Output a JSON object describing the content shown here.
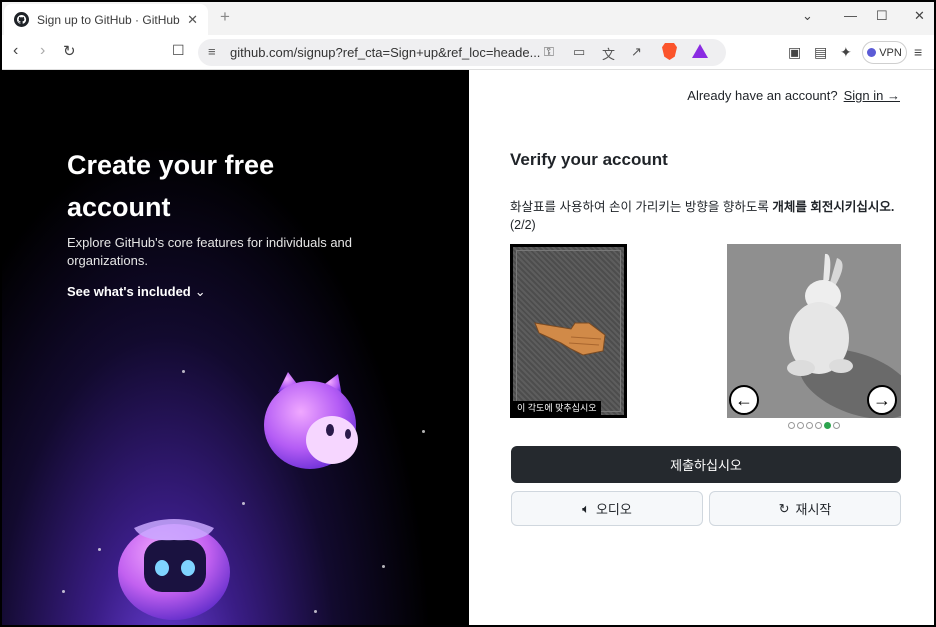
{
  "browser": {
    "tab_title": "Sign up to GitHub · GitHub",
    "tab_close": "✕",
    "new_tab": "+",
    "url": "github.com/signup?ref_cta=Sign+up&ref_loc=heade...",
    "vpn_label": "VPN",
    "window_controls": [
      "⌄",
      "—",
      "☐",
      "✕"
    ]
  },
  "left_panel": {
    "headline": "Create your free account",
    "subtext": "Explore GitHub's core features for individuals and organizations.",
    "see_more": "See what's included",
    "see_more_icon": "chevron-down-icon"
  },
  "right_panel": {
    "already_text": "Already have an account?",
    "sign_in": "Sign in →",
    "verify_title": "Verify your account",
    "instruction_part1": "화살표를 사용하여 손이 가리키는 방향을 향하도록 ",
    "instruction_bold": "개체를 회전시키십시오.",
    "instruction_counter": " (2/2)",
    "reference_caption": "이 각도에 맞추십시오",
    "prev_arrow": "←",
    "next_arrow": "→",
    "carousel": {
      "total": 6,
      "active_index": 4
    },
    "submit_label": "제출하십시오",
    "audio_label": "오디오",
    "audio_icon": "speaker-icon",
    "restart_label": "재시작",
    "restart_icon": "refresh-icon"
  },
  "colors": {
    "submit_bg": "#25292e",
    "accent_green": "#2da44e",
    "left_bg": "#000000"
  }
}
